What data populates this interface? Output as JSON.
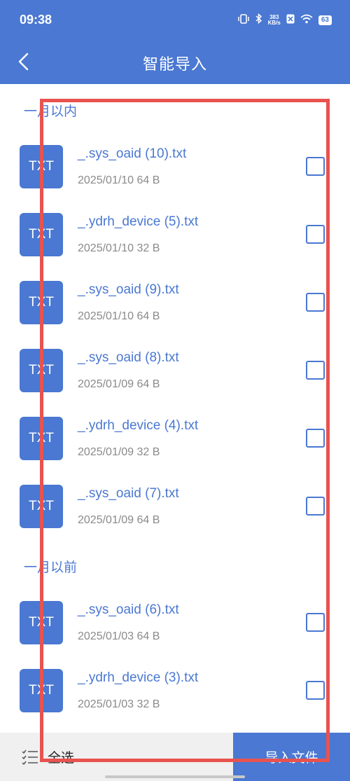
{
  "status_bar": {
    "time": "09:38",
    "net_speed_value": "383",
    "net_speed_unit": "KB/s",
    "battery": "63"
  },
  "header": {
    "title": "智能导入"
  },
  "sections": [
    {
      "title": "一月以内"
    },
    {
      "title": "一月以前"
    }
  ],
  "files": [
    {
      "badge": "TXT",
      "name": "_.sys_oaid (10).txt",
      "meta": "2025/01/10 64 B",
      "checked": false
    },
    {
      "badge": "TXT",
      "name": "_.ydrh_device (5).txt",
      "meta": "2025/01/10 32 B",
      "checked": false
    },
    {
      "badge": "TXT",
      "name": "_.sys_oaid (9).txt",
      "meta": "2025/01/10 64 B",
      "checked": false
    },
    {
      "badge": "TXT",
      "name": "_.sys_oaid (8).txt",
      "meta": "2025/01/09 64 B",
      "checked": false
    },
    {
      "badge": "TXT",
      "name": "_.ydrh_device (4).txt",
      "meta": "2025/01/09 32 B",
      "checked": false
    },
    {
      "badge": "TXT",
      "name": "_.sys_oaid (7).txt",
      "meta": "2025/01/09 64 B",
      "checked": false
    },
    {
      "badge": "TXT",
      "name": "_.sys_oaid (6).txt",
      "meta": "2025/01/03 64 B",
      "checked": false
    },
    {
      "badge": "TXT",
      "name": "_.ydrh_device (3).txt",
      "meta": "2025/01/03 32 B",
      "checked": false
    }
  ],
  "bottom_bar": {
    "select_all_label": "全选",
    "import_label": "导入文件"
  },
  "colors": {
    "primary": "#4a78d2",
    "highlight": "#e8534f",
    "meta_text": "#8a8a8a"
  },
  "icons": {
    "back": "chevron-left-icon",
    "select_all": "checklist-icon",
    "vibrate": "vibrate-icon",
    "bluetooth": "bluetooth-icon",
    "sim": "no-sim-icon",
    "wifi": "wifi-icon"
  }
}
